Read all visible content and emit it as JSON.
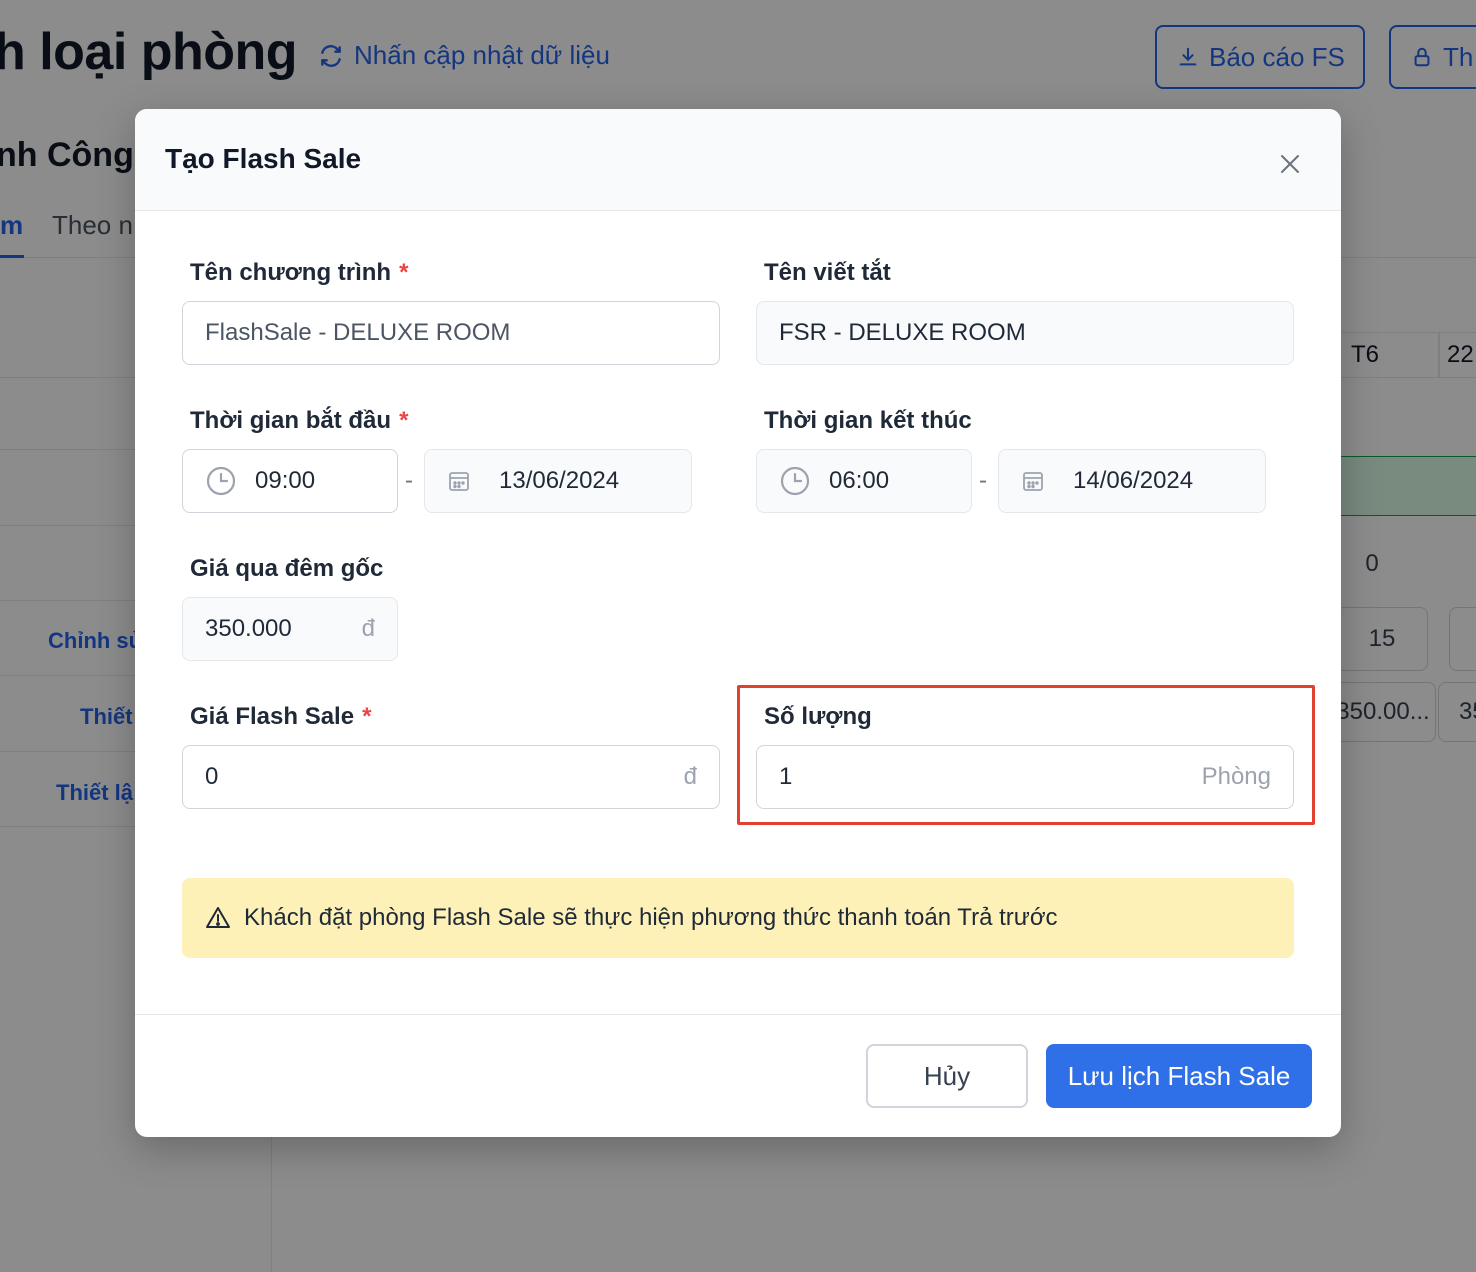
{
  "background": {
    "page_title": "h loại phòng",
    "refresh_label": "Nhấn cập nhật dữ liệu",
    "report_button": "Báo cáo FS",
    "lock_button": "Th",
    "hotel_name": "nh Công",
    "tab_active": "m",
    "tab_other": "Theo n",
    "sidebar_links": [
      "Chỉnh sử",
      "Thiết",
      "Thiết lậ"
    ],
    "column_heads": [
      "T6",
      "22"
    ],
    "cells": {
      "zero": "0",
      "fifteen": "15",
      "price": "350.00...",
      "price_partial": "35"
    }
  },
  "modal": {
    "title": "Tạo Flash Sale",
    "required_mark": "*",
    "program_name": {
      "label": "Tên chương trình",
      "value": "FlashSale - DELUXE ROOM"
    },
    "short_name": {
      "label": "Tên viết tắt",
      "value": "FSR - DELUXE ROOM"
    },
    "start": {
      "label": "Thời gian bắt đầu",
      "time": "09:00",
      "date": "13/06/2024"
    },
    "end": {
      "label": "Thời gian kết thúc",
      "time": "06:00",
      "date": "14/06/2024"
    },
    "separator": "-",
    "original_price": {
      "label": "Giá qua đêm gốc",
      "value": "350.000",
      "currency": "đ"
    },
    "flash_price": {
      "label": "Giá Flash Sale",
      "value": "0",
      "currency": "đ"
    },
    "quantity": {
      "label": "Số lượng",
      "value": "1",
      "unit": "Phòng"
    },
    "notice": "Khách đặt phòng Flash Sale sẽ thực hiện phương thức thanh toán Trả trước",
    "cancel_button": "Hủy",
    "save_button": "Lưu lịch Flash Sale"
  },
  "colors": {
    "primary": "#2f6fe8",
    "required": "#ef4444",
    "highlight": "#e0422f",
    "notice_bg": "#fdf1b8"
  }
}
